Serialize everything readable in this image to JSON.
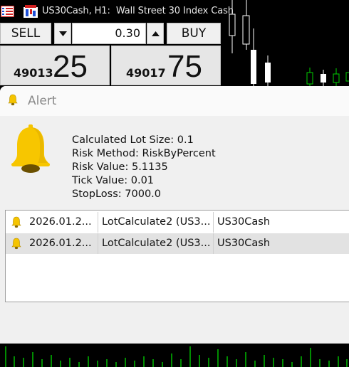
{
  "chart": {
    "title": "US30Cash, H1:  Wall Street 30 Index Cash",
    "colors": {
      "background": "#000000",
      "bull": "#00d000",
      "bear": "#ffffff"
    }
  },
  "trade_panel": {
    "sell_label": "SELL",
    "buy_label": "BUY",
    "lot_value": "0.30",
    "bid_prefix": "49013",
    "bid_big": "25",
    "ask_prefix": "49017",
    "ask_big": "75"
  },
  "alert": {
    "title": "Alert",
    "message_lines": [
      "Calculated Lot Size: 0.1",
      "Risk Method: RiskByPercent",
      "Risk Value: 5.1135",
      "Tick Value: 0.01",
      "StopLoss: 7000.0"
    ],
    "rows": [
      {
        "time": "2026.01.2...",
        "name": "LotCalculate2 (US3...",
        "symbol": "US30Cash",
        "icon": "bell-icon"
      },
      {
        "time": "2026.01.2...",
        "name": "LotCalculate2 (US3...",
        "symbol": "US30Cash",
        "icon": "bell-icon"
      }
    ],
    "colors": {
      "bell": "#f5c400",
      "selected_row": "#e2e2e2"
    }
  }
}
